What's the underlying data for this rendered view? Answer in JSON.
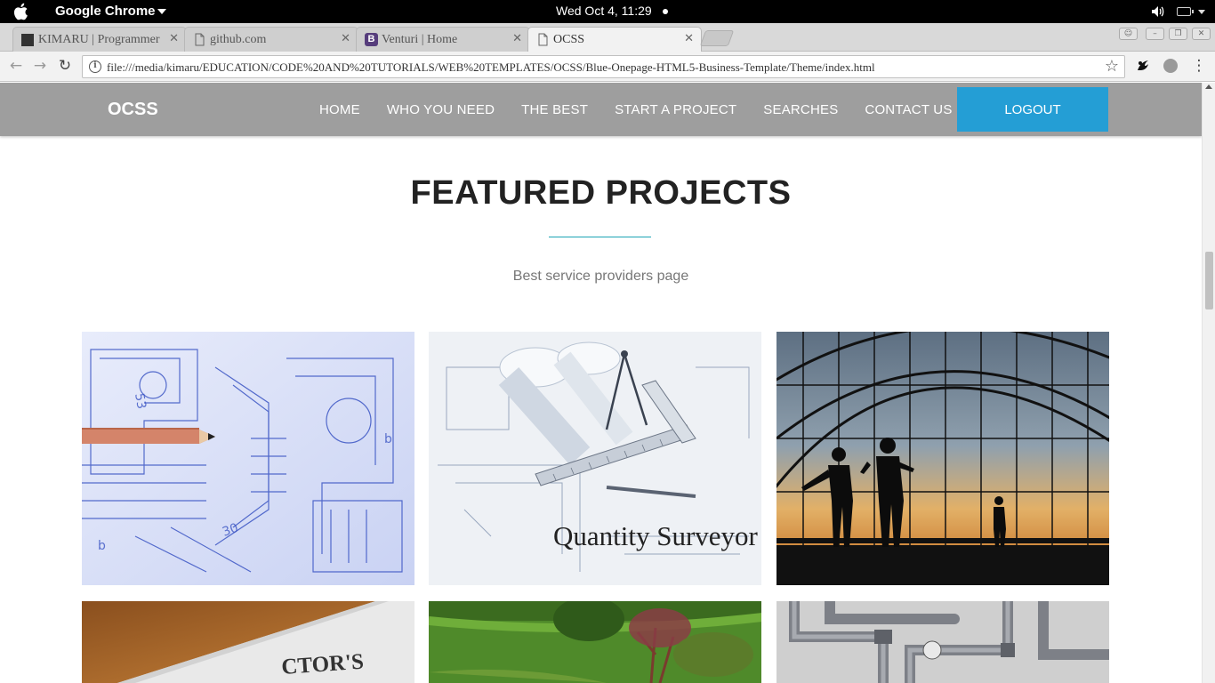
{
  "os": {
    "app_name": "Google Chrome",
    "clock": "Wed Oct  4, 11:29"
  },
  "browser": {
    "tabs": [
      {
        "label": "KIMARU | Programmer",
        "favicon": "dark-square-icon"
      },
      {
        "label": "github.com",
        "favicon": "page-icon"
      },
      {
        "label": "Venturi | Home",
        "favicon": "bootstrap-icon"
      },
      {
        "label": "OCSS",
        "favicon": "page-icon"
      }
    ],
    "url": "file:///media/kimaru/EDUCATION/CODE%20AND%20TUTORIALS/WEB%20TEMPLATES/OCSS/Blue-Onepage-HTML5-Business-Template/Theme/index.html"
  },
  "site": {
    "brand": "OCSS",
    "nav": [
      "HOME",
      "WHO YOU NEED",
      "THE BEST",
      "START A PROJECT",
      "SEARCHES",
      "CONTACT US"
    ],
    "logout_label": "LOGOUT",
    "accent_color": "#249ed5",
    "nav_bg": "#9e9e9e"
  },
  "featured": {
    "title": "FEATURED PROJECTS",
    "subtitle": "Best service providers page",
    "cards": [
      {
        "name": "architect-blueprint",
        "caption": ""
      },
      {
        "name": "quantity-surveyor",
        "caption": "Quantity Surveyor"
      },
      {
        "name": "construction-site",
        "caption": ""
      },
      {
        "name": "contractor-card",
        "caption": "CTOR'S"
      },
      {
        "name": "landscaping",
        "caption": ""
      },
      {
        "name": "plumbing",
        "caption": ""
      }
    ]
  }
}
